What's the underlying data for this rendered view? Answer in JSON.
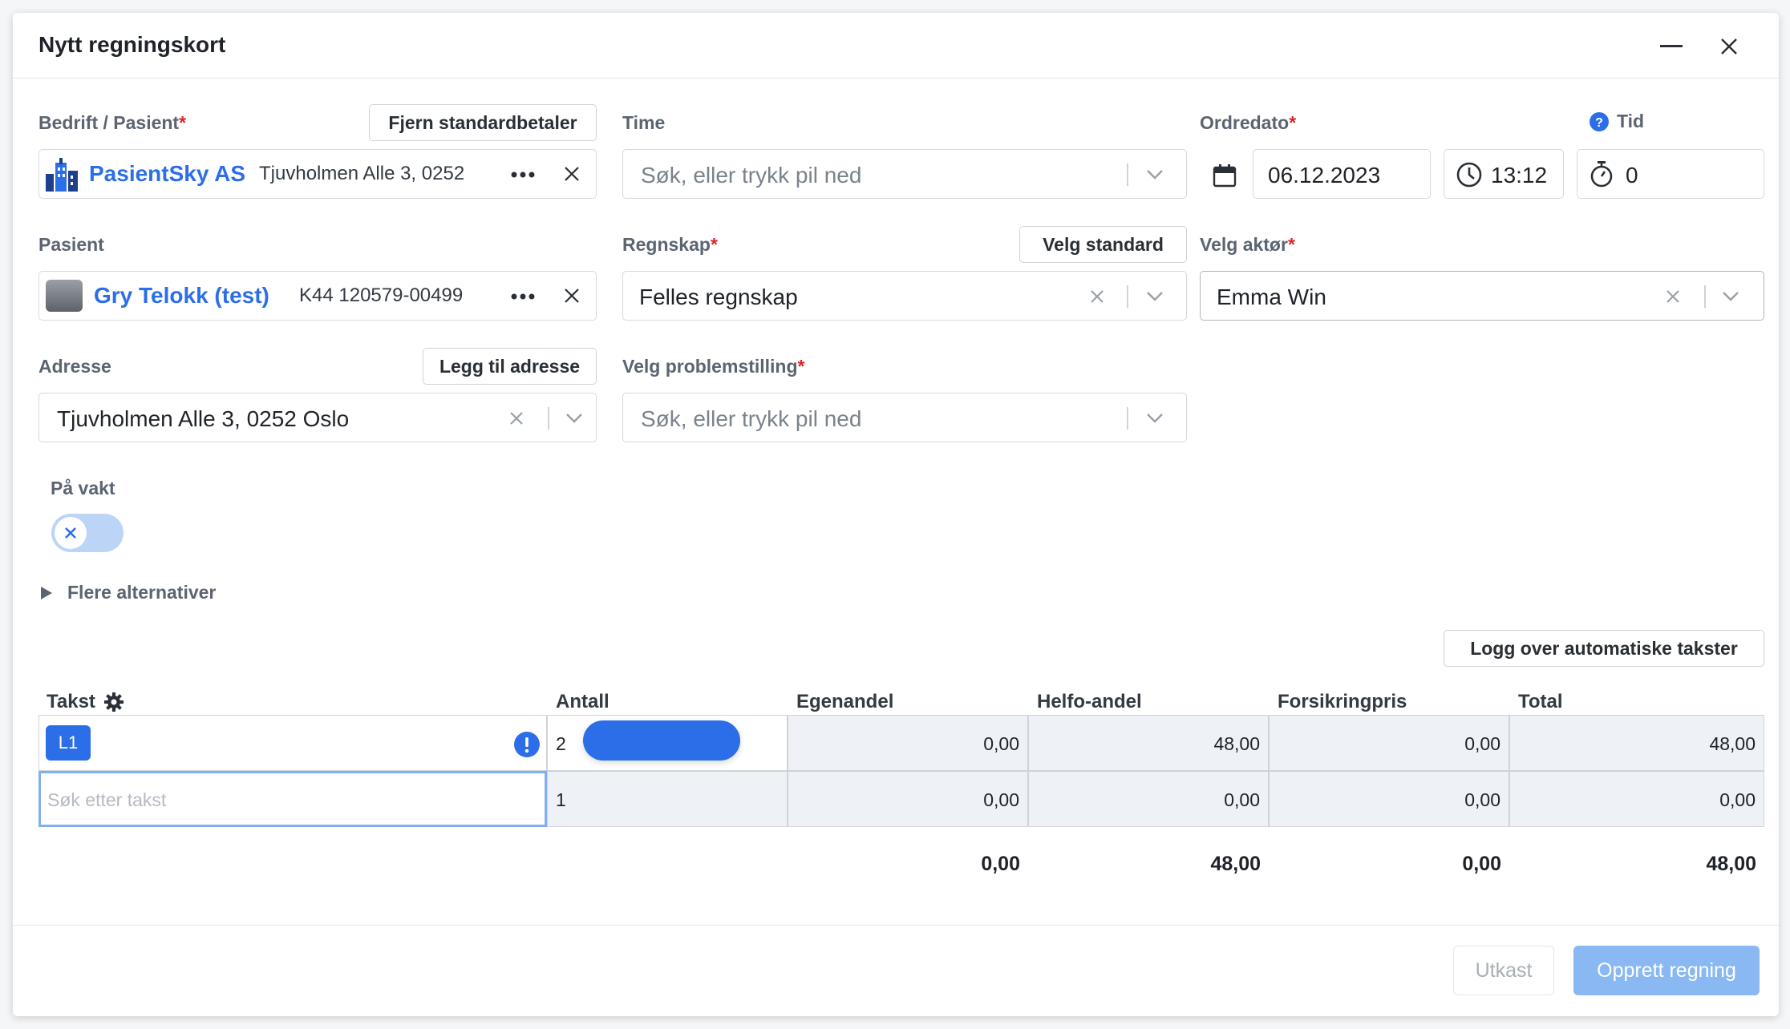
{
  "dialog": {
    "title": "Nytt regningskort"
  },
  "left": {
    "company_label": "Bedrift / Pasient",
    "remove_default_payer": "Fjern standardbetaler",
    "company_name": "PasientSky AS",
    "company_address": "Tjuvholmen Alle 3, 0252",
    "patient_label": "Pasient",
    "patient_name": "Gry Telokk (test)",
    "patient_id": "K44 120579-00499",
    "address_label": "Adresse",
    "add_address": "Legg til adresse",
    "address_value": "Tjuvholmen Alle 3, 0252 Oslo",
    "on_duty_label": "På vakt",
    "more_options": "Flere alternativer"
  },
  "middle": {
    "time_label": "Time",
    "time_placeholder": "Søk, eller trykk pil ned",
    "accounting_label": "Regnskap",
    "set_default": "Velg standard",
    "accounting_value": "Felles regnskap",
    "problem_label": "Velg problemstilling",
    "problem_placeholder": "Søk, eller trykk pil ned"
  },
  "right": {
    "order_date_label": "Ordredato",
    "order_date": "06.12.2023",
    "order_time": "13:12",
    "tid_label": "Tid",
    "tid_value": "0",
    "actor_label": "Velg aktør",
    "actor_value": "Emma Win"
  },
  "table": {
    "log_button": "Logg over automatiske takster",
    "headers": [
      "Takst",
      "Antall",
      "Egenandel",
      "Helfo-andel",
      "Forsikringpris",
      "Total"
    ],
    "rows": [
      {
        "code": "L1",
        "antall": "2",
        "egenandel": "0,00",
        "helfo": "48,00",
        "forsikring": "0,00",
        "total": "48,00"
      },
      {
        "search_placeholder": "Søk etter takst",
        "antall": "1",
        "egenandel": "0,00",
        "helfo": "0,00",
        "forsikring": "0,00",
        "total": "0,00"
      }
    ],
    "totals": {
      "egenandel": "0,00",
      "helfo": "48,00",
      "forsikring": "0,00",
      "total": "48,00"
    }
  },
  "footer": {
    "draft": "Utkast",
    "create": "Opprett regning"
  },
  "colors": {
    "accent": "#2b6ee8",
    "required": "#d9262b",
    "primary_disabled": "#8ab8f2",
    "toggle_off": "#bcd5f7"
  }
}
